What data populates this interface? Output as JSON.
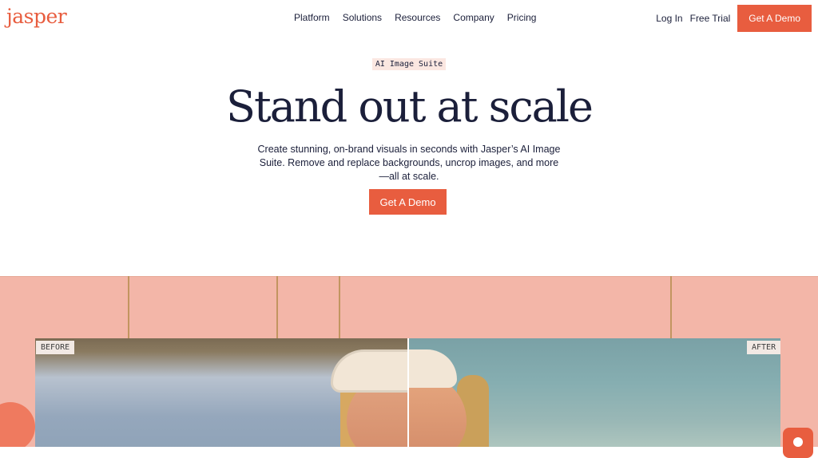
{
  "nav": {
    "logo": "jasper",
    "menu": [
      "Platform",
      "Solutions",
      "Resources",
      "Company",
      "Pricing"
    ],
    "login": "Log In",
    "free_trial": "Free Trial",
    "demo": "Get A Demo"
  },
  "hero": {
    "kicker": "AI Image Suite",
    "headline": "Stand out at scale",
    "subtext": "Create stunning, on-brand visuals in seconds with Jasper’s AI Image Suite. Remove and replace backgrounds, uncrop images, and more—all at scale.",
    "cta": "Get A Demo"
  },
  "showcase": {
    "before_label": "BEFORE",
    "after_label": "AFTER"
  },
  "colors": {
    "accent": "#e85d3f",
    "navy": "#1b1f3a",
    "peach_bg": "#f3b6a8"
  }
}
